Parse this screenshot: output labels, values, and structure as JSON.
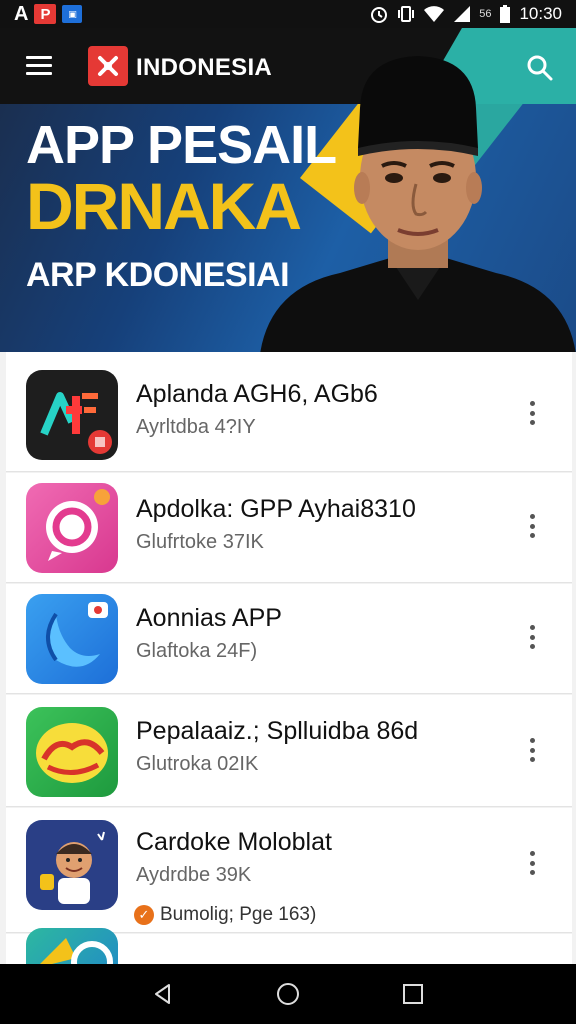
{
  "status_bar": {
    "left_letter": "A",
    "left_badge": "P",
    "network": "56",
    "time": "10:30"
  },
  "header": {
    "brand": "INDONESIA"
  },
  "banner": {
    "line1": "APP PESAIL",
    "line2": "DRNAKA",
    "line3": "ARP KDONESIAI"
  },
  "apps": [
    {
      "title": "Aplanda AGH6, AGb6",
      "subtitle": "Ayrltdba 4?IY"
    },
    {
      "title": "Apdolka: GPP Ayhai8310",
      "subtitle": "Glufrtoke 37IK"
    },
    {
      "title": "Aonnias APP",
      "subtitle": "Glaftoka 24F)"
    },
    {
      "title": "Pepalaaiz.; Splluidba 86d",
      "subtitle": "Glutroka 02IK"
    },
    {
      "title": "Cardoke Moloblat",
      "subtitle": "Aydrdbe 39K",
      "extra": "Bumolig; Pge 163)"
    }
  ],
  "colors": {
    "accent_yellow": "#f3c21a",
    "brand_red": "#e53935",
    "teal": "#2bb0a6"
  }
}
